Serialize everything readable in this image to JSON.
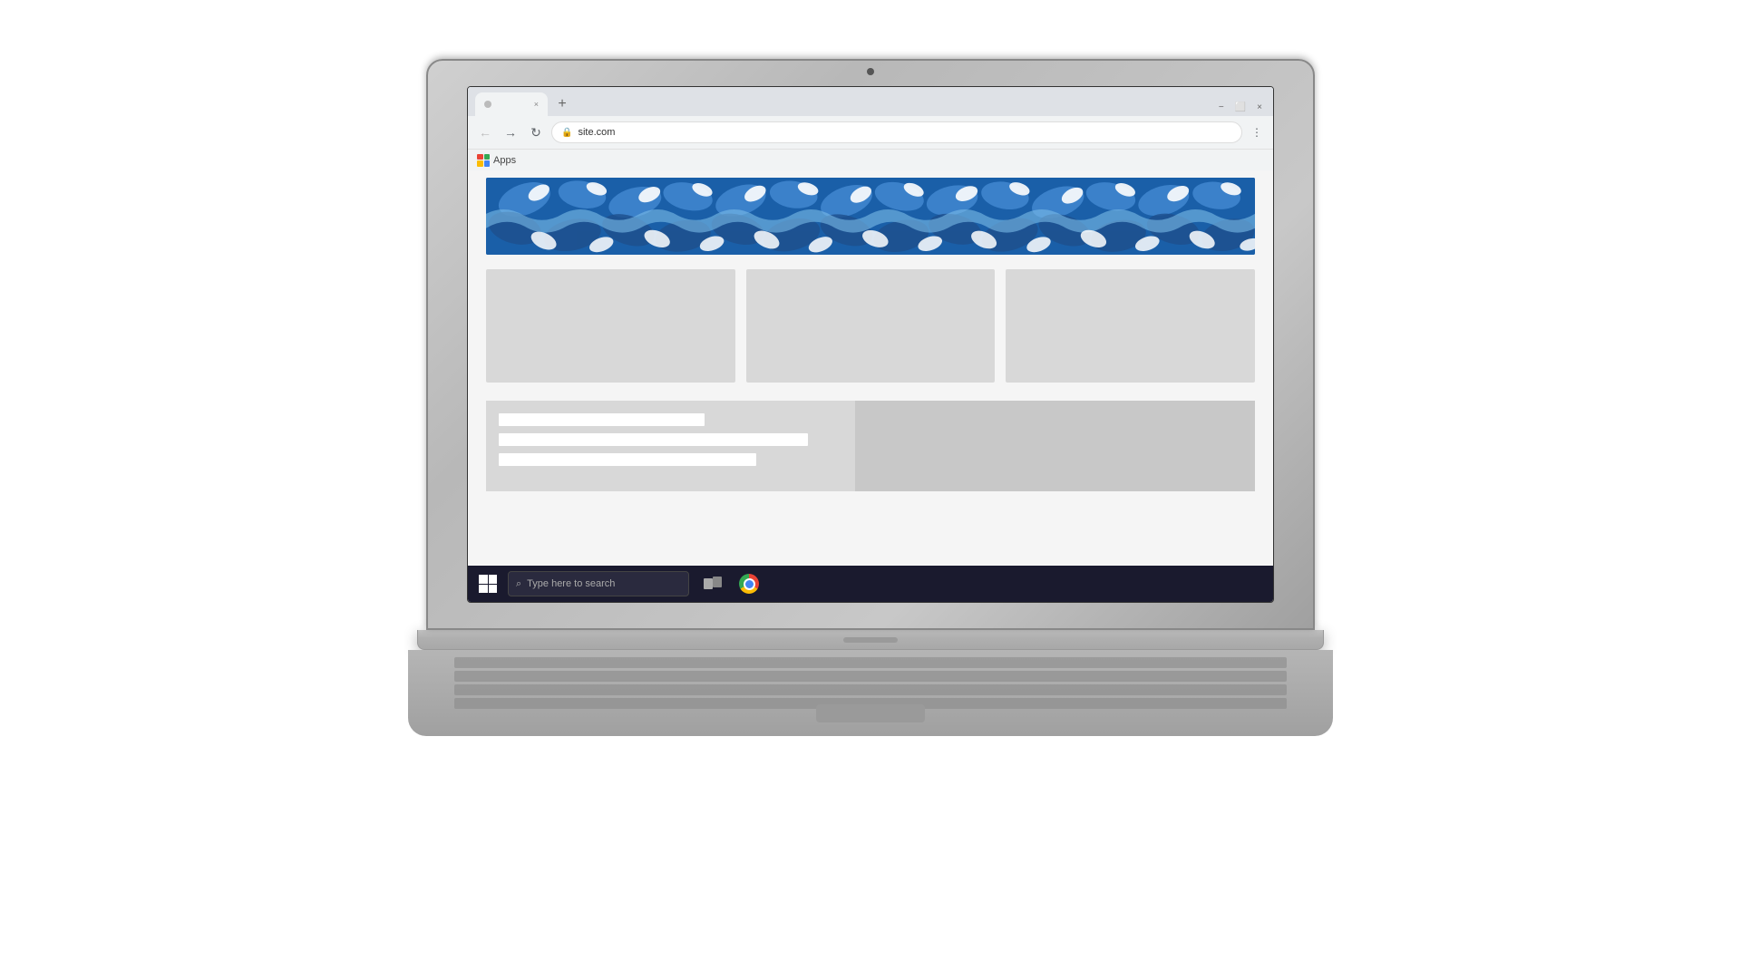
{
  "laptop": {
    "camera_label": "camera"
  },
  "browser": {
    "tab_label": "",
    "url": "site.com",
    "new_tab_symbol": "+",
    "close_symbol": "×",
    "minimize_symbol": "−",
    "restore_symbol": "⬜",
    "win_close_symbol": "×",
    "back_symbol": "←",
    "forward_symbol": "→",
    "refresh_symbol": "↻",
    "lock_symbol": "🔒",
    "apps_label": "Apps",
    "toolbar_icons": [
      "⋮"
    ]
  },
  "webpage": {
    "header_pattern": "blue-floral-wave",
    "cards": [
      {
        "id": "card-1"
      },
      {
        "id": "card-2"
      },
      {
        "id": "card-3"
      }
    ],
    "form_fields": [
      {
        "width": "60%"
      },
      {
        "width": "90%"
      },
      {
        "width": "75%"
      }
    ]
  },
  "taskbar": {
    "start_label": "Start",
    "search_placeholder": "Type here to search",
    "apps": [
      {
        "name": "Task View"
      },
      {
        "name": "Chrome"
      }
    ]
  }
}
